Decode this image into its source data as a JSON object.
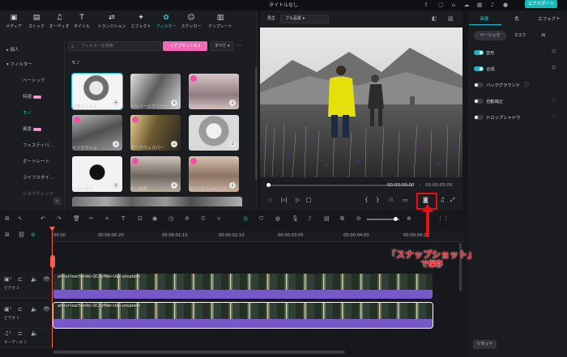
{
  "window": {
    "title": "タイトルなし",
    "export_label": "エクスポート"
  },
  "toolbar_tabs": [
    {
      "label": "メディア",
      "icon": "media-icon"
    },
    {
      "label": "ストック",
      "icon": "stock-icon"
    },
    {
      "label": "オーディオ",
      "icon": "audio-icon"
    },
    {
      "label": "タイトル",
      "icon": "title-icon"
    },
    {
      "label": "トランジション",
      "icon": "transition-icon"
    },
    {
      "label": "エフェクト",
      "icon": "effect-icon"
    },
    {
      "label": "フィルター",
      "icon": "filter-icon"
    },
    {
      "label": "ステッカー",
      "icon": "sticker-icon"
    },
    {
      "label": "テンプレート",
      "icon": "template-icon"
    }
  ],
  "sidebar": {
    "items": [
      {
        "label": "個人",
        "kind": "group"
      },
      {
        "label": "フィルター",
        "kind": "group"
      },
      {
        "label": "ベーシック",
        "kind": "item"
      },
      {
        "label": "特選",
        "kind": "item",
        "badge": "NEW"
      },
      {
        "label": "モノ",
        "kind": "item",
        "active": true
      },
      {
        "label": "風景",
        "kind": "item",
        "badge": "NEW"
      },
      {
        "label": "フェスティバ…",
        "kind": "item"
      },
      {
        "label": "ポートレート",
        "kind": "item"
      },
      {
        "label": "ライフスタイ…",
        "kind": "item"
      },
      {
        "label": "シネマティック",
        "kind": "item"
      }
    ]
  },
  "filter_browser": {
    "search_placeholder": "フィルターを検索",
    "preset_label": "ィアプセット6.1",
    "sort_label": "すべて",
    "section_title": "モノ",
    "items": [
      {
        "name": "白黒フィルム",
        "selected": true
      },
      {
        "name": "シルバースクリーン",
        "selected": false
      },
      {
        "name": "ピンクグレー",
        "selected": false
      },
      {
        "name": "インクディム",
        "selected": false
      },
      {
        "name": "ダークウィスパー",
        "selected": false
      },
      {
        "name": "インクウェル",
        "selected": false
      },
      {
        "name": "シンシティ",
        "selected": false
      },
      {
        "name": "古い新聞",
        "selected": false
      },
      {
        "name": "エイジドエッセンス",
        "selected": false
      }
    ]
  },
  "preview": {
    "label": "再生",
    "quality": "フル品質",
    "timecode_current": "00:00:00:00",
    "timecode_total": "00:00:05:00"
  },
  "properties": {
    "tabs": [
      "画像",
      "色",
      "エフェクト"
    ],
    "subtabs": [
      "ベーシック",
      "マスク",
      "AI"
    ],
    "items": [
      {
        "label": "変形",
        "enabled": true
      },
      {
        "label": "合成",
        "enabled": true
      },
      {
        "label": "バックグラウンド",
        "enabled": false
      },
      {
        "label": "自動補正",
        "enabled": false
      },
      {
        "label": "ドロップシャドウ",
        "enabled": false
      }
    ],
    "reset_label": "リセット"
  },
  "timeline": {
    "ruler": [
      "00:00",
      "00:00:00:20",
      "00:00:01:15",
      "00:00:02:10",
      "00:00:03:05",
      "00:00:04:00",
      "00:00:04:20"
    ],
    "tracks": [
      {
        "label": "ビデオ 2",
        "clip_title": "annur-isachenko-QCoyfNei-Uqs-unsplash"
      },
      {
        "label": "ビデオ 1",
        "clip_title": "annur-isachenko-QCoyfNei-Uqs-unsplash"
      },
      {
        "label": "オーディオ 1"
      }
    ]
  },
  "annotation": {
    "line1": "「スナップショット」",
    "line2": "で保存"
  },
  "colors": {
    "accent": "#21c6d6",
    "brand_export": "#18b7b8",
    "clip": "#7758c8",
    "annotation_red": "#e40f18"
  }
}
